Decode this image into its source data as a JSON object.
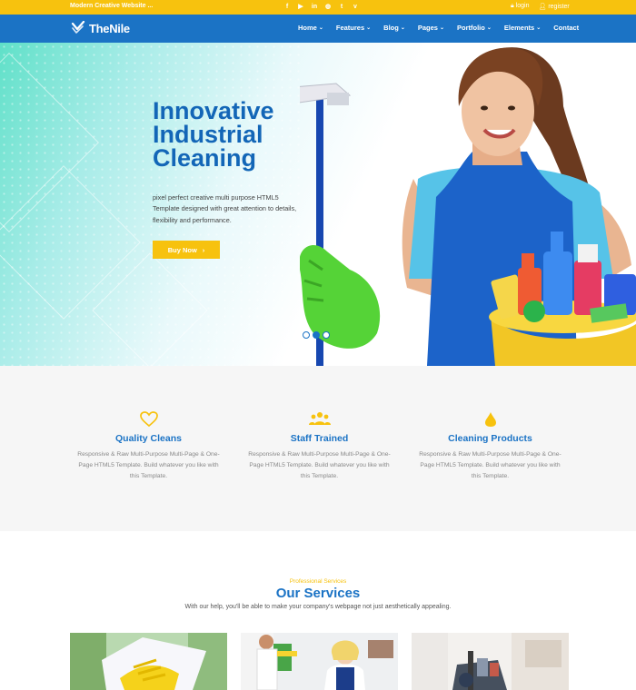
{
  "topbar": {
    "tagline": "Modern Creative Website ...",
    "socials": [
      {
        "icon": "facebook-icon",
        "glyph": "f"
      },
      {
        "icon": "youtube-icon",
        "glyph": "▶"
      },
      {
        "icon": "linkedin-icon",
        "glyph": "in"
      },
      {
        "icon": "dribbble-icon",
        "glyph": "◍"
      },
      {
        "icon": "twitter-icon",
        "glyph": "t"
      },
      {
        "icon": "vimeo-icon",
        "glyph": "v"
      }
    ],
    "login_label": "login",
    "register_label": "register"
  },
  "nav": {
    "brand": "TheNile",
    "items": [
      {
        "label": "Home",
        "dropdown": true
      },
      {
        "label": "Features",
        "dropdown": true
      },
      {
        "label": "Blog",
        "dropdown": true
      },
      {
        "label": "Pages",
        "dropdown": true
      },
      {
        "label": "Portfolio",
        "dropdown": true
      },
      {
        "label": "Elements",
        "dropdown": true
      },
      {
        "label": "Contact",
        "dropdown": false
      }
    ]
  },
  "hero": {
    "title_lines": [
      "Innovative",
      "Industrial",
      "Cleaning"
    ],
    "description": "pixel perfect creative multi purpose HTML5 Template designed with great attention to details, flexibility and performance.",
    "button_label": "Buy Now",
    "slides": 3,
    "active_slide": 2
  },
  "features": [
    {
      "icon": "heart-icon",
      "title": "Quality Cleans",
      "text": "Responsive & Raw Multi-Purpose Multi-Page & One-Page HTML5 Template. Build whatever you like with this Template."
    },
    {
      "icon": "users-icon",
      "title": "Staff Trained",
      "text": "Responsive & Raw Multi-Purpose Multi-Page & One-Page HTML5 Template. Build whatever you like with this Template."
    },
    {
      "icon": "drop-icon",
      "title": "Cleaning Products",
      "text": "Responsive & Raw Multi-Purpose Multi-Page & One-Page HTML5 Template. Build whatever you like with this Template."
    }
  ],
  "services": {
    "subtitle": "Professional Services",
    "title": "Our Services",
    "description": "With our help, you'll be able to make your company's webpage not just aesthetically appealing."
  },
  "colors": {
    "accent_yellow": "#f7c20e",
    "primary_blue": "#1b73c5",
    "title_blue": "#1366b7"
  }
}
